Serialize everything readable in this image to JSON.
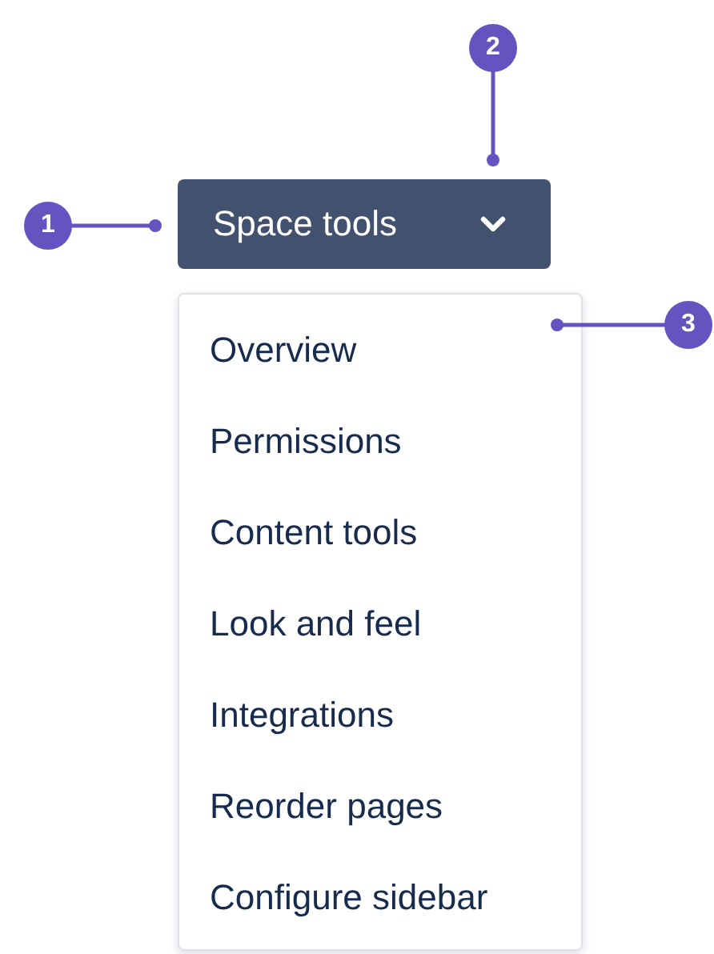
{
  "button": {
    "label": "Space tools"
  },
  "menu": {
    "items": [
      {
        "label": "Overview"
      },
      {
        "label": "Permissions"
      },
      {
        "label": "Content tools"
      },
      {
        "label": "Look and feel"
      },
      {
        "label": "Integrations"
      },
      {
        "label": "Reorder pages"
      },
      {
        "label": "Configure sidebar"
      }
    ]
  },
  "callouts": [
    {
      "number": "1"
    },
    {
      "number": "2"
    },
    {
      "number": "3"
    }
  ]
}
